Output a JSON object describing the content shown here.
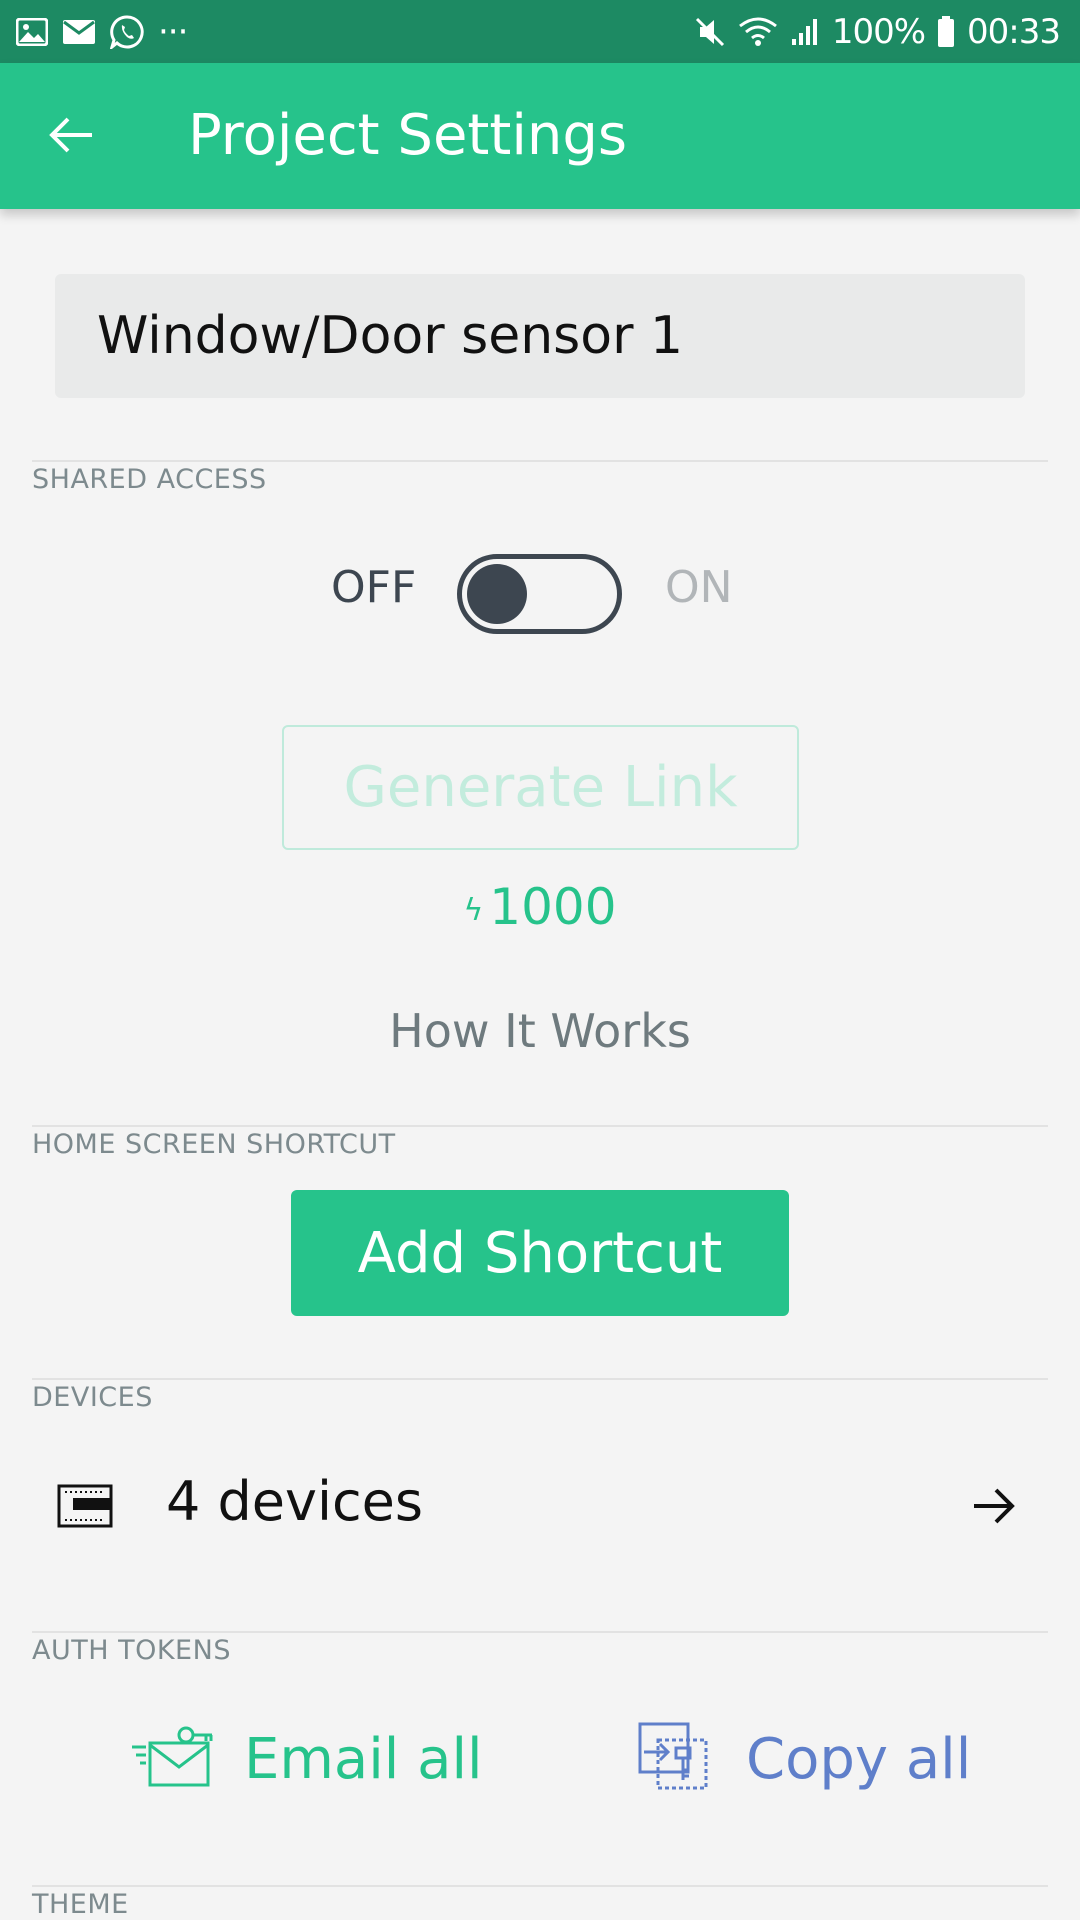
{
  "status_bar": {
    "battery": "100%",
    "time": "00:33",
    "more": "···"
  },
  "app_bar": {
    "title": "Project Settings"
  },
  "project": {
    "name": "Window/Door sensor 1"
  },
  "shared_access": {
    "section_label": "SHARED ACCESS",
    "off_label": "OFF",
    "on_label": "ON",
    "toggle_state": "off",
    "generate_link_label": "Generate Link",
    "energy_cost": "1000",
    "energy_symbol": "ϟ",
    "how_it_works_label": "How It Works"
  },
  "home_screen_shortcut": {
    "section_label": "HOME SCREEN SHORTCUT",
    "button_label": "Add Shortcut"
  },
  "devices": {
    "section_label": "DEVICES",
    "summary": "4 devices"
  },
  "auth_tokens": {
    "section_label": "AUTH TOKENS",
    "email_all_label": "Email all",
    "copy_all_label": "Copy all"
  },
  "theme": {
    "section_label": "THEME"
  },
  "colors": {
    "accent": "#26c38b",
    "status_bar": "#1d8a63",
    "copy_blue": "#5f7fca",
    "toggle_dark": "#3d4650"
  },
  "icons": {
    "status_left": [
      "gallery-icon",
      "mail-icon",
      "whatsapp-icon"
    ],
    "status_right": [
      "mute-icon",
      "wifi-icon",
      "signal-icon",
      "battery-icon"
    ]
  }
}
